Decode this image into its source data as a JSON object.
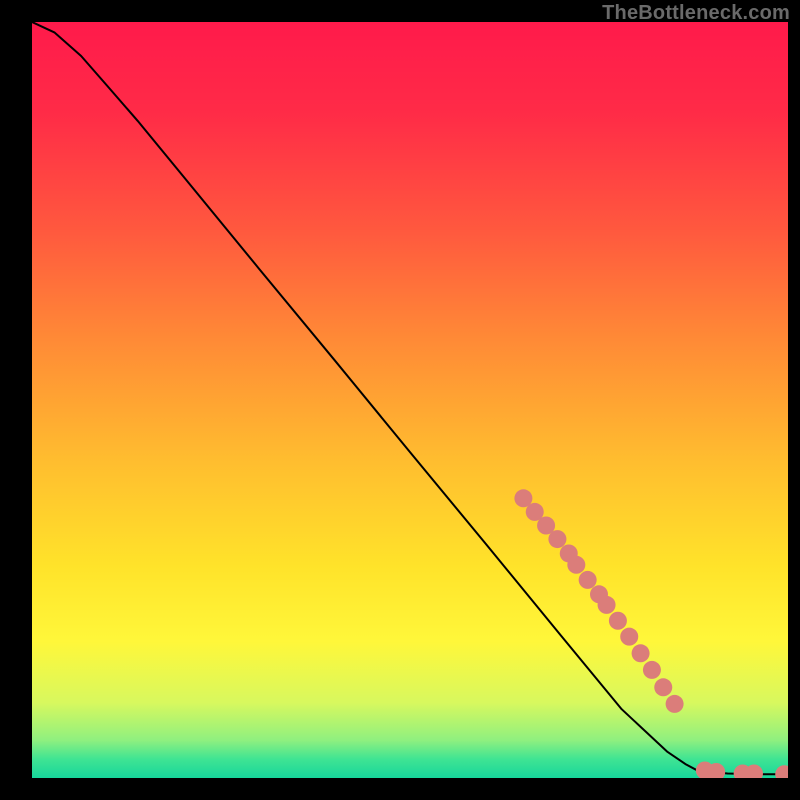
{
  "watermark": "TheBottleneck.com",
  "chart_data": {
    "type": "line",
    "title": "",
    "xlabel": "",
    "ylabel": "",
    "xlim": [
      0,
      100
    ],
    "ylim": [
      0,
      100
    ],
    "axes_visible": false,
    "grid": false,
    "background_gradient": {
      "stops": [
        {
          "offset": 0.0,
          "color": "#ff1a4b"
        },
        {
          "offset": 0.12,
          "color": "#ff2b47"
        },
        {
          "offset": 0.28,
          "color": "#ff5a3e"
        },
        {
          "offset": 0.42,
          "color": "#ff8a36"
        },
        {
          "offset": 0.58,
          "color": "#ffbd2f"
        },
        {
          "offset": 0.72,
          "color": "#ffe32a"
        },
        {
          "offset": 0.82,
          "color": "#fff73a"
        },
        {
          "offset": 0.9,
          "color": "#d8f85e"
        },
        {
          "offset": 0.95,
          "color": "#8ff07f"
        },
        {
          "offset": 0.975,
          "color": "#3fe493"
        },
        {
          "offset": 1.0,
          "color": "#17d69b"
        }
      ]
    },
    "series": [
      {
        "name": "curve",
        "stroke": "#000000",
        "stroke_width": 2,
        "points": [
          {
            "x": 0.0,
            "y": 100.0
          },
          {
            "x": 3.0,
            "y": 98.6
          },
          {
            "x": 6.5,
            "y": 95.5
          },
          {
            "x": 10.0,
            "y": 91.5
          },
          {
            "x": 14.0,
            "y": 86.9
          },
          {
            "x": 20.0,
            "y": 79.6
          },
          {
            "x": 30.0,
            "y": 67.4
          },
          {
            "x": 40.0,
            "y": 55.3
          },
          {
            "x": 50.0,
            "y": 43.1
          },
          {
            "x": 60.0,
            "y": 31.0
          },
          {
            "x": 70.0,
            "y": 18.8
          },
          {
            "x": 78.0,
            "y": 9.1
          },
          {
            "x": 84.0,
            "y": 3.5
          },
          {
            "x": 86.5,
            "y": 1.8
          },
          {
            "x": 88.0,
            "y": 1.0
          },
          {
            "x": 92.0,
            "y": 0.6
          },
          {
            "x": 96.0,
            "y": 0.5
          },
          {
            "x": 100.0,
            "y": 0.5
          }
        ]
      }
    ],
    "markers": {
      "name": "highlight-dots",
      "fill": "#db7d7a",
      "radius": 9,
      "points": [
        {
          "x": 65.0,
          "y": 37.0
        },
        {
          "x": 66.5,
          "y": 35.2
        },
        {
          "x": 68.0,
          "y": 33.4
        },
        {
          "x": 69.5,
          "y": 31.6
        },
        {
          "x": 71.0,
          "y": 29.7
        },
        {
          "x": 72.0,
          "y": 28.2
        },
        {
          "x": 73.5,
          "y": 26.2
        },
        {
          "x": 75.0,
          "y": 24.3
        },
        {
          "x": 76.0,
          "y": 22.9
        },
        {
          "x": 77.5,
          "y": 20.8
        },
        {
          "x": 79.0,
          "y": 18.7
        },
        {
          "x": 80.5,
          "y": 16.5
        },
        {
          "x": 82.0,
          "y": 14.3
        },
        {
          "x": 83.5,
          "y": 12.0
        },
        {
          "x": 85.0,
          "y": 9.8
        },
        {
          "x": 89.0,
          "y": 1.0
        },
        {
          "x": 90.5,
          "y": 0.8
        },
        {
          "x": 94.0,
          "y": 0.6
        },
        {
          "x": 95.5,
          "y": 0.6
        },
        {
          "x": 99.5,
          "y": 0.5
        }
      ]
    }
  }
}
